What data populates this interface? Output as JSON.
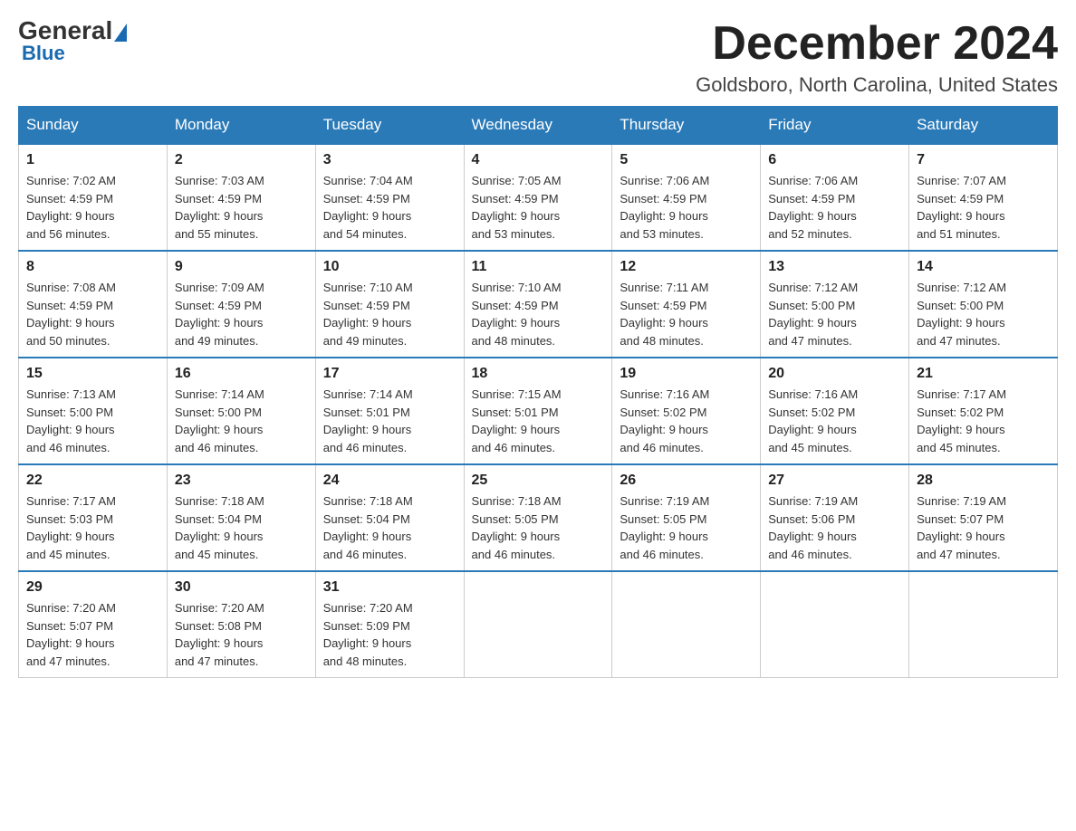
{
  "header": {
    "logo": {
      "general": "General",
      "blue": "Blue"
    },
    "month": "December 2024",
    "location": "Goldsboro, North Carolina, United States"
  },
  "weekdays": [
    "Sunday",
    "Monday",
    "Tuesday",
    "Wednesday",
    "Thursday",
    "Friday",
    "Saturday"
  ],
  "weeks": [
    [
      {
        "day": "1",
        "sunrise": "7:02 AM",
        "sunset": "4:59 PM",
        "daylight": "9 hours and 56 minutes."
      },
      {
        "day": "2",
        "sunrise": "7:03 AM",
        "sunset": "4:59 PM",
        "daylight": "9 hours and 55 minutes."
      },
      {
        "day": "3",
        "sunrise": "7:04 AM",
        "sunset": "4:59 PM",
        "daylight": "9 hours and 54 minutes."
      },
      {
        "day": "4",
        "sunrise": "7:05 AM",
        "sunset": "4:59 PM",
        "daylight": "9 hours and 53 minutes."
      },
      {
        "day": "5",
        "sunrise": "7:06 AM",
        "sunset": "4:59 PM",
        "daylight": "9 hours and 53 minutes."
      },
      {
        "day": "6",
        "sunrise": "7:06 AM",
        "sunset": "4:59 PM",
        "daylight": "9 hours and 52 minutes."
      },
      {
        "day": "7",
        "sunrise": "7:07 AM",
        "sunset": "4:59 PM",
        "daylight": "9 hours and 51 minutes."
      }
    ],
    [
      {
        "day": "8",
        "sunrise": "7:08 AM",
        "sunset": "4:59 PM",
        "daylight": "9 hours and 50 minutes."
      },
      {
        "day": "9",
        "sunrise": "7:09 AM",
        "sunset": "4:59 PM",
        "daylight": "9 hours and 49 minutes."
      },
      {
        "day": "10",
        "sunrise": "7:10 AM",
        "sunset": "4:59 PM",
        "daylight": "9 hours and 49 minutes."
      },
      {
        "day": "11",
        "sunrise": "7:10 AM",
        "sunset": "4:59 PM",
        "daylight": "9 hours and 48 minutes."
      },
      {
        "day": "12",
        "sunrise": "7:11 AM",
        "sunset": "4:59 PM",
        "daylight": "9 hours and 48 minutes."
      },
      {
        "day": "13",
        "sunrise": "7:12 AM",
        "sunset": "5:00 PM",
        "daylight": "9 hours and 47 minutes."
      },
      {
        "day": "14",
        "sunrise": "7:12 AM",
        "sunset": "5:00 PM",
        "daylight": "9 hours and 47 minutes."
      }
    ],
    [
      {
        "day": "15",
        "sunrise": "7:13 AM",
        "sunset": "5:00 PM",
        "daylight": "9 hours and 46 minutes."
      },
      {
        "day": "16",
        "sunrise": "7:14 AM",
        "sunset": "5:00 PM",
        "daylight": "9 hours and 46 minutes."
      },
      {
        "day": "17",
        "sunrise": "7:14 AM",
        "sunset": "5:01 PM",
        "daylight": "9 hours and 46 minutes."
      },
      {
        "day": "18",
        "sunrise": "7:15 AM",
        "sunset": "5:01 PM",
        "daylight": "9 hours and 46 minutes."
      },
      {
        "day": "19",
        "sunrise": "7:16 AM",
        "sunset": "5:02 PM",
        "daylight": "9 hours and 46 minutes."
      },
      {
        "day": "20",
        "sunrise": "7:16 AM",
        "sunset": "5:02 PM",
        "daylight": "9 hours and 45 minutes."
      },
      {
        "day": "21",
        "sunrise": "7:17 AM",
        "sunset": "5:02 PM",
        "daylight": "9 hours and 45 minutes."
      }
    ],
    [
      {
        "day": "22",
        "sunrise": "7:17 AM",
        "sunset": "5:03 PM",
        "daylight": "9 hours and 45 minutes."
      },
      {
        "day": "23",
        "sunrise": "7:18 AM",
        "sunset": "5:04 PM",
        "daylight": "9 hours and 45 minutes."
      },
      {
        "day": "24",
        "sunrise": "7:18 AM",
        "sunset": "5:04 PM",
        "daylight": "9 hours and 46 minutes."
      },
      {
        "day": "25",
        "sunrise": "7:18 AM",
        "sunset": "5:05 PM",
        "daylight": "9 hours and 46 minutes."
      },
      {
        "day": "26",
        "sunrise": "7:19 AM",
        "sunset": "5:05 PM",
        "daylight": "9 hours and 46 minutes."
      },
      {
        "day": "27",
        "sunrise": "7:19 AM",
        "sunset": "5:06 PM",
        "daylight": "9 hours and 46 minutes."
      },
      {
        "day": "28",
        "sunrise": "7:19 AM",
        "sunset": "5:07 PM",
        "daylight": "9 hours and 47 minutes."
      }
    ],
    [
      {
        "day": "29",
        "sunrise": "7:20 AM",
        "sunset": "5:07 PM",
        "daylight": "9 hours and 47 minutes."
      },
      {
        "day": "30",
        "sunrise": "7:20 AM",
        "sunset": "5:08 PM",
        "daylight": "9 hours and 47 minutes."
      },
      {
        "day": "31",
        "sunrise": "7:20 AM",
        "sunset": "5:09 PM",
        "daylight": "9 hours and 48 minutes."
      },
      null,
      null,
      null,
      null
    ]
  ],
  "labels": {
    "sunrise": "Sunrise:",
    "sunset": "Sunset:",
    "daylight": "Daylight:"
  }
}
